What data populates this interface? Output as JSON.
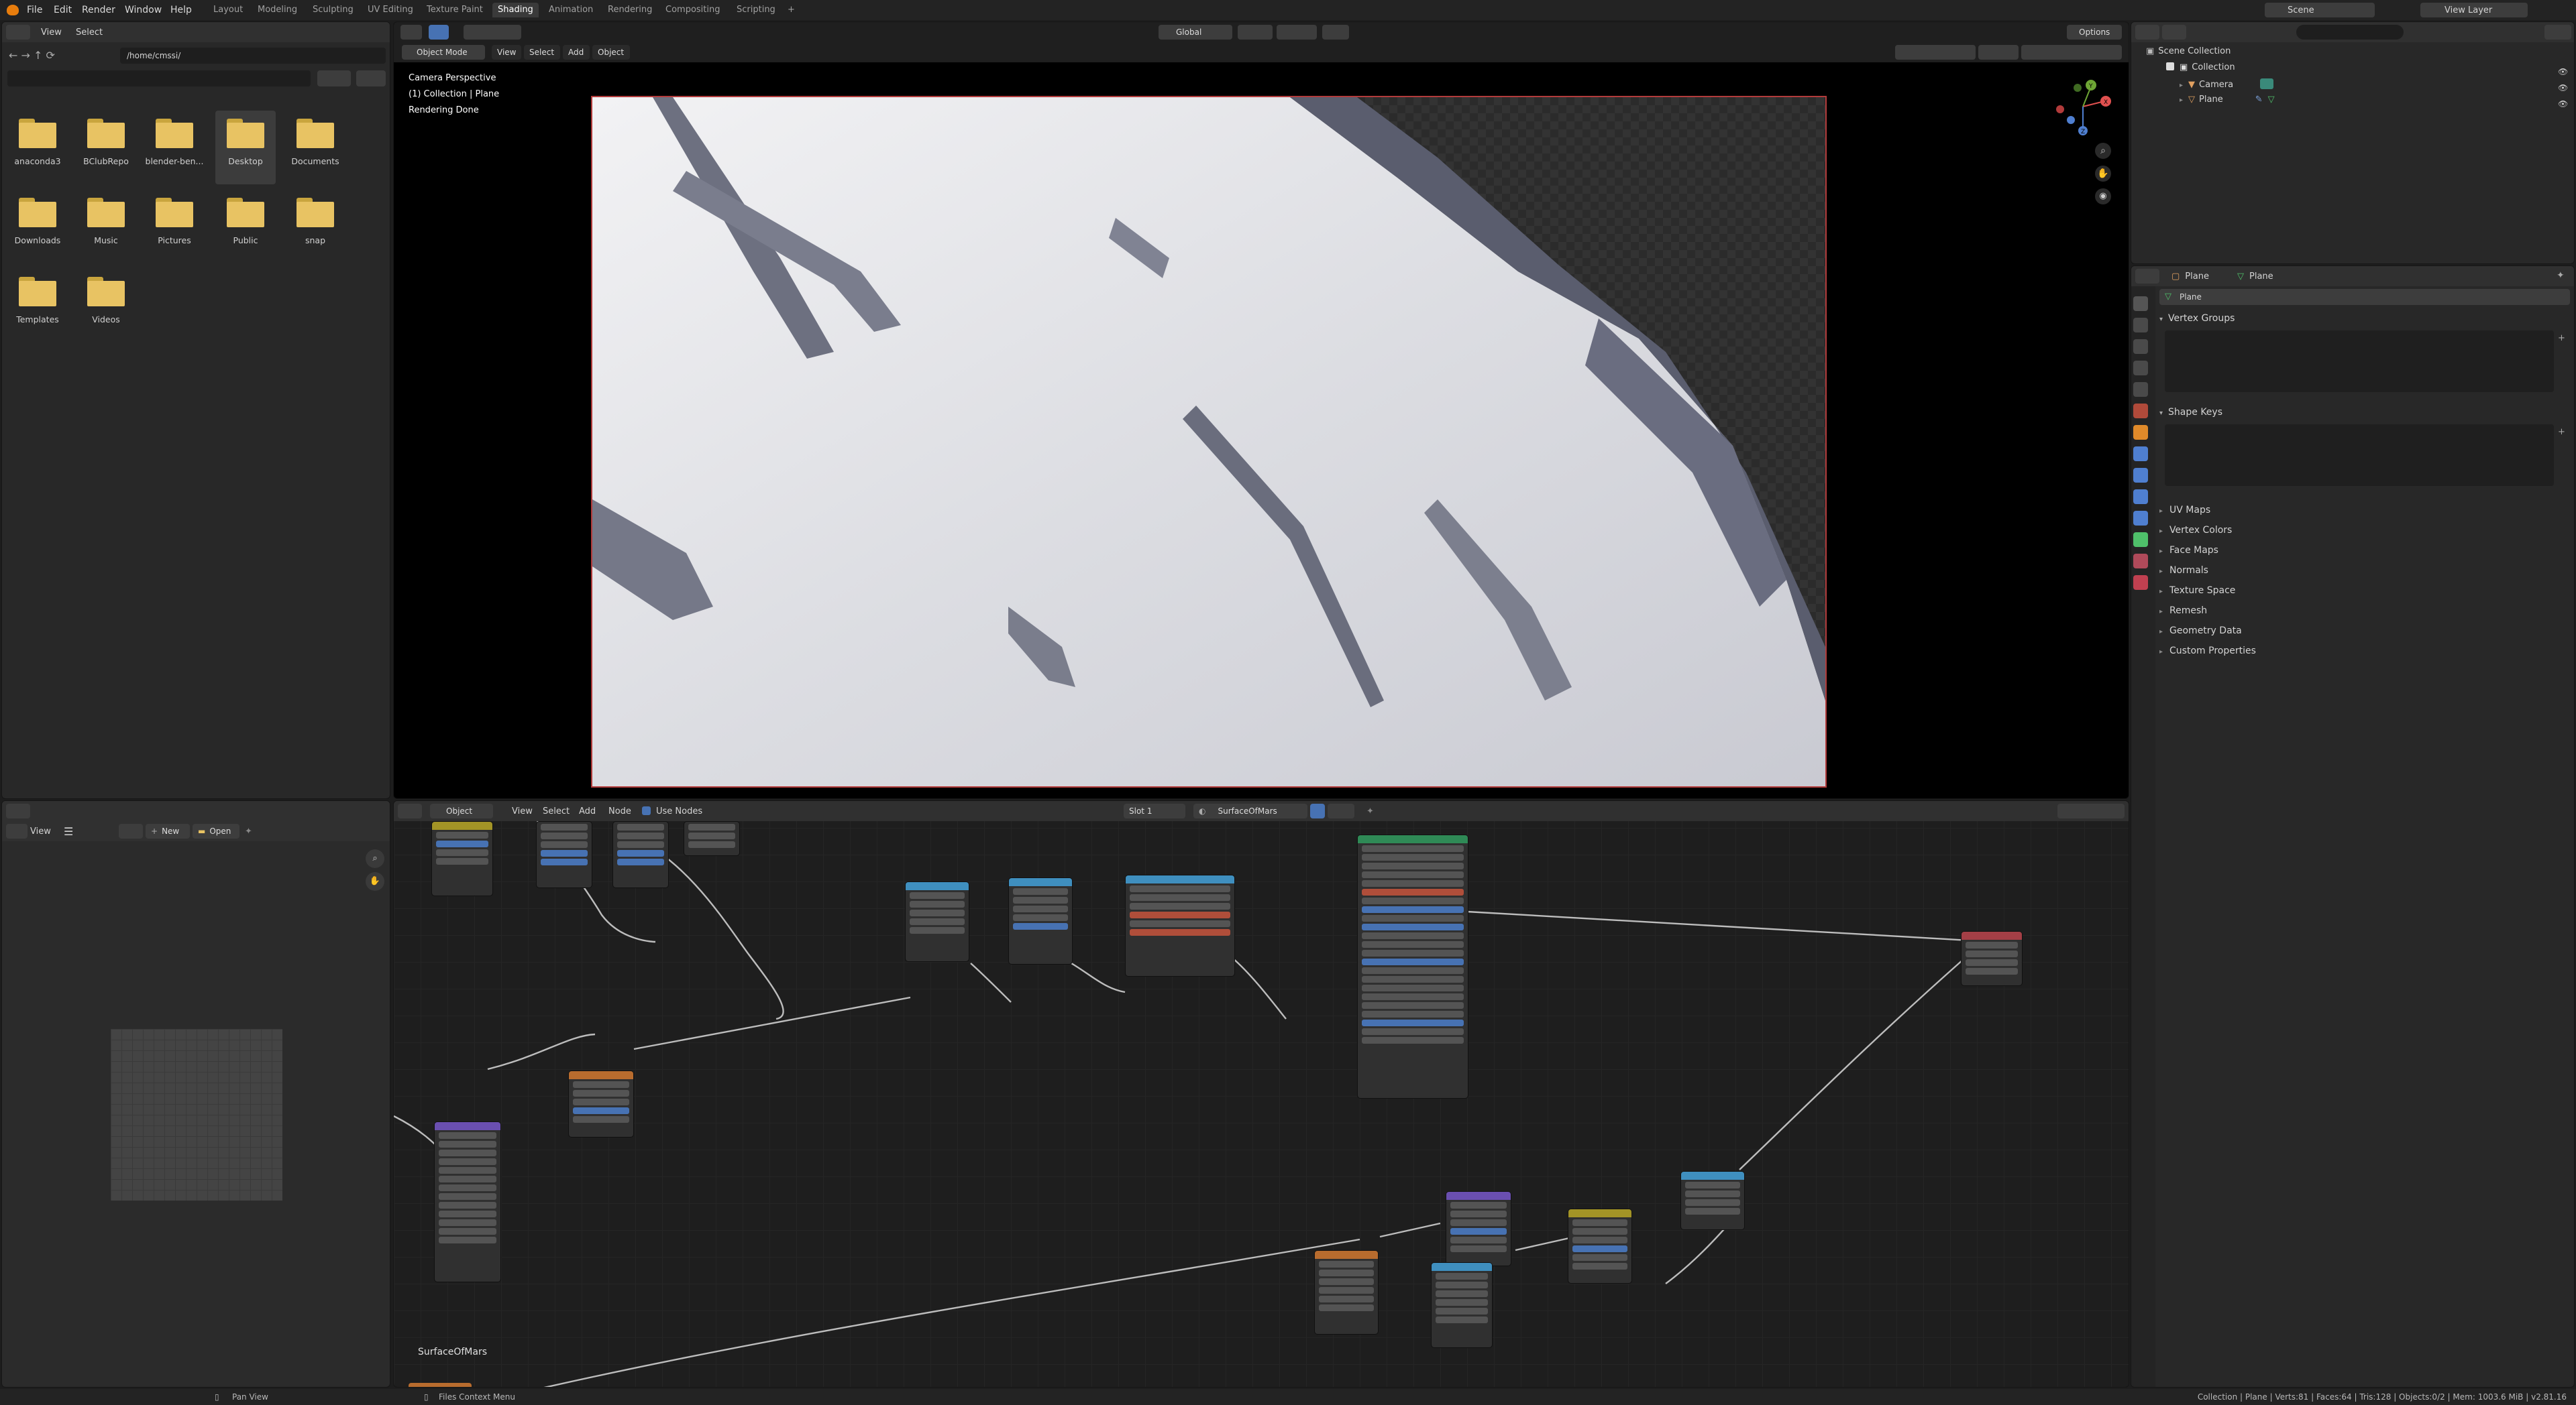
{
  "topbar": {
    "menus": [
      "File",
      "Edit",
      "Render",
      "Window",
      "Help"
    ],
    "workspaces": [
      "Layout",
      "Modeling",
      "Sculpting",
      "UV Editing",
      "Texture Paint",
      "Shading",
      "Animation",
      "Rendering",
      "Compositing",
      "Scripting"
    ],
    "active_workspace": "Shading",
    "add_tab": "+",
    "scene_label": "Scene",
    "view_layer_label": "View Layer"
  },
  "file_browser": {
    "menus": [
      "View",
      "Select"
    ],
    "path": "/home/cmssi/",
    "folders": [
      "anaconda3",
      "BClubRepo",
      "blender-ben...",
      "Desktop",
      "Documents",
      "Downloads",
      "Music",
      "Pictures",
      "Public",
      "snap",
      "Templates",
      "Videos"
    ],
    "selected_folder": "Desktop"
  },
  "viewport": {
    "mode": "Object Mode",
    "menus": [
      "View",
      "Select",
      "Add",
      "Object"
    ],
    "transform": "Global",
    "options": "Options",
    "overlay_lines": [
      "Camera Perspective",
      "(1) Collection | Plane",
      "Rendering Done"
    ],
    "gizmo_axes": [
      "X",
      "Y",
      "Z"
    ]
  },
  "outliner": {
    "root": "Scene Collection",
    "items": [
      "Collection",
      "Camera",
      "Plane"
    ]
  },
  "properties": {
    "object_name": "Plane",
    "data_name": "Plane",
    "mesh_field": "Plane",
    "panels_open": [
      "Vertex Groups",
      "Shape Keys"
    ],
    "panels_closed": [
      "UV Maps",
      "Vertex Colors",
      "Face Maps",
      "Normals",
      "Texture Space",
      "Remesh",
      "Geometry Data",
      "Custom Properties"
    ]
  },
  "image_editor": {
    "menus": [
      "View"
    ],
    "new_button": "New",
    "open_button": "Open"
  },
  "node_editor": {
    "object_dropdown": "Object",
    "menus": [
      "View",
      "Select",
      "Add",
      "Node"
    ],
    "use_nodes_label": "Use Nodes",
    "slot": "Slot 1",
    "material": "SurfaceOfMars",
    "tree_label": "SurfaceOfMars"
  },
  "status": {
    "left": "Pan View",
    "middle": "Files Context Menu",
    "right": "Collection | Plane | Verts:81 | Faces:64 | Tris:128 | Objects:0/2 | Mem: 1003.6 MiB | v2.81.16"
  },
  "colors": {
    "accent": "#4772b3",
    "folder": "#e8c363",
    "node_principled": "#2f8a56",
    "node_output": "#a43f46",
    "node_vector": "#6a4fb0",
    "node_texture": "#b86c2e",
    "node_converter": "#3f8fbf",
    "node_color": "#a39426"
  }
}
